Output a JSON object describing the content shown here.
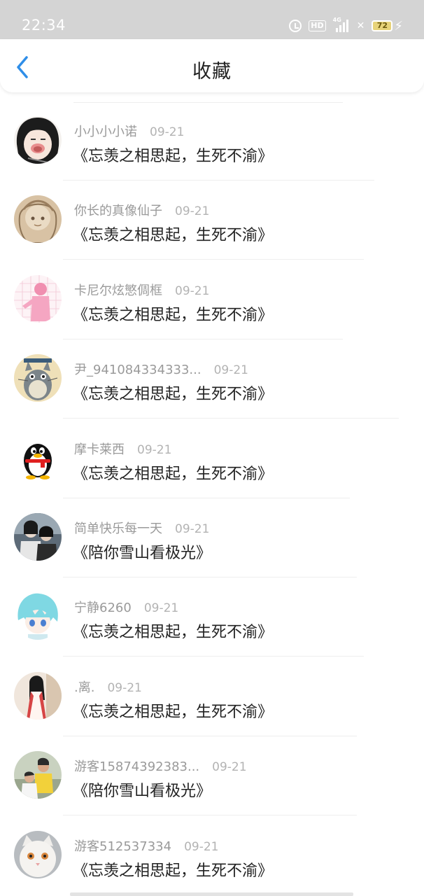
{
  "status_bar": {
    "time": "22:34",
    "hd": "HD",
    "network": "4G",
    "battery": "72",
    "icons": [
      "alarm-icon",
      "hd-icon",
      "signal-icon",
      "wifi-off-icon",
      "battery-icon",
      "charging-bolt-icon"
    ]
  },
  "header": {
    "title": "收藏",
    "back_icon": "chevron-left-icon",
    "accent": "#2f8ee8"
  },
  "items": [
    {
      "nickname": "小小小小诺",
      "date": "09-21",
      "title": "《忘羡之相思起，生死不渝》",
      "avatar": "anime-girl-avatar"
    },
    {
      "nickname": "你长的真像仙子",
      "date": "09-21",
      "title": "《忘羡之相思起，生死不渝》",
      "avatar": "sketch-avatar"
    },
    {
      "nickname": "卡尼尔炫慜倜框",
      "date": "09-21",
      "title": "《忘羡之相思起，生死不渝》",
      "avatar": "pink-figure-avatar"
    },
    {
      "nickname": "尹_941084334333...",
      "date": "09-21",
      "title": "《忘羡之相思起，生死不渝》",
      "avatar": "totoro-avatar"
    },
    {
      "nickname": "摩卡莱西",
      "date": "09-21",
      "title": "《忘羡之相思起，生死不渝》",
      "avatar": "qq-penguin-avatar"
    },
    {
      "nickname": "简单快乐每一天",
      "date": "09-21",
      "title": "《陪你雪山看极光》",
      "avatar": "costume-duo-avatar"
    },
    {
      "nickname": "宁静6260",
      "date": "09-21",
      "title": "《忘羡之相思起，生死不渝》",
      "avatar": "anime-boy-avatar"
    },
    {
      "nickname": ".离.",
      "date": "09-21",
      "title": "《忘羡之相思起，生死不渝》",
      "avatar": "girl-red-dress-avatar"
    },
    {
      "nickname": "游客15874392383...",
      "date": "09-21",
      "title": "《陪你雪山看极光》",
      "avatar": "kids-photo-avatar"
    },
    {
      "nickname": "游客512537334",
      "date": "09-21",
      "title": "《忘羡之相思起，生死不渝》",
      "avatar": "white-cat-avatar"
    }
  ]
}
